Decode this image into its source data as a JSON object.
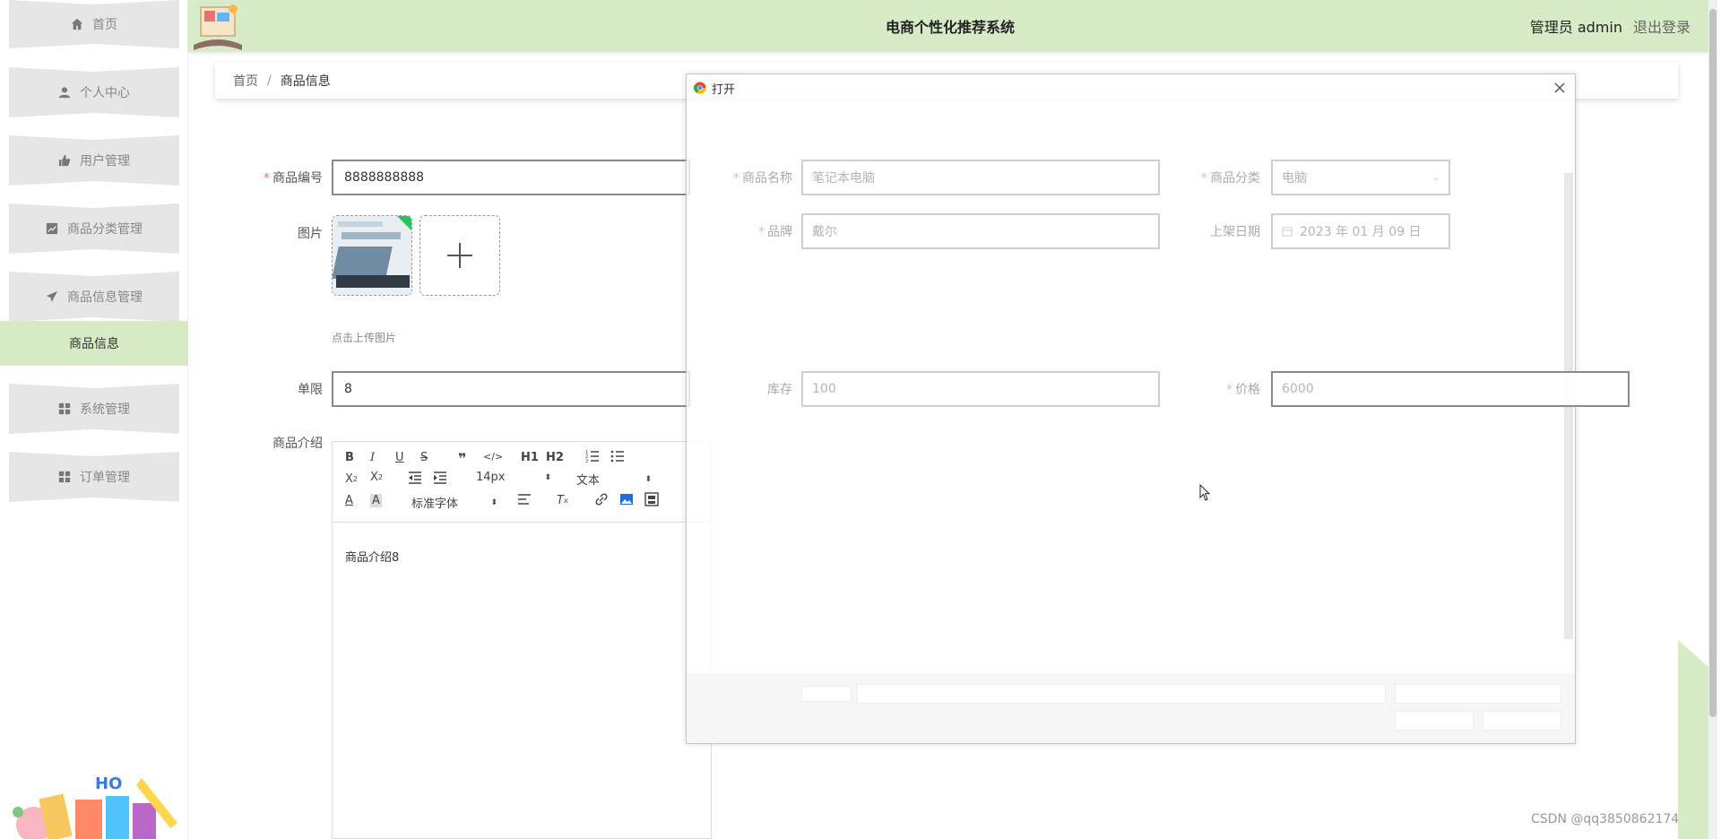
{
  "app": {
    "title": "电商个性化推荐系统",
    "user_label": "管理员 admin",
    "logout_label": "退出登录"
  },
  "sidebar": {
    "items": [
      {
        "label": "首页",
        "icon": "home-icon"
      },
      {
        "label": "个人中心",
        "icon": "user-icon"
      },
      {
        "label": "用户管理",
        "icon": "thumbs-up-icon"
      },
      {
        "label": "商品分类管理",
        "icon": "chart-icon"
      },
      {
        "label": "商品信息管理",
        "icon": "paper-plane-icon"
      },
      {
        "label": "系统管理",
        "icon": "grid-icon"
      },
      {
        "label": "订单管理",
        "icon": "grid-icon"
      }
    ],
    "active_submenu": "商品信息"
  },
  "breadcrumb": {
    "home": "首页",
    "separator": "/",
    "current": "商品信息"
  },
  "form": {
    "product_code": {
      "label": "商品编号",
      "value": "8888888888",
      "required": true
    },
    "image": {
      "label": "图片",
      "hint": "点击上传图片"
    },
    "limit": {
      "label": "单限",
      "value": "8"
    },
    "description": {
      "label": "商品介绍",
      "content": "商品介绍8"
    },
    "product_name": {
      "label": "商品名称",
      "value": "笔记本电脑",
      "required": true
    },
    "category": {
      "label": "商品分类",
      "value": "电脑",
      "required": true
    },
    "brand": {
      "label": "品牌",
      "value": "戴尔",
      "required": true
    },
    "listing_date": {
      "label": "上架日期",
      "value": "2023 年 01 月 09 日"
    },
    "stock": {
      "label": "库存",
      "value": "100"
    },
    "price": {
      "label": "价格",
      "value": "6000",
      "required": true
    }
  },
  "editor": {
    "font_size": "14px",
    "block_type": "文本",
    "font_family": "标准字体",
    "h1": "H1",
    "h2": "H2"
  },
  "dialog": {
    "title": "打开"
  },
  "watermark": "CSDN @qq3850862174",
  "colors": {
    "accent_green": "#d7ebc7",
    "required_red": "#f56c6c"
  }
}
